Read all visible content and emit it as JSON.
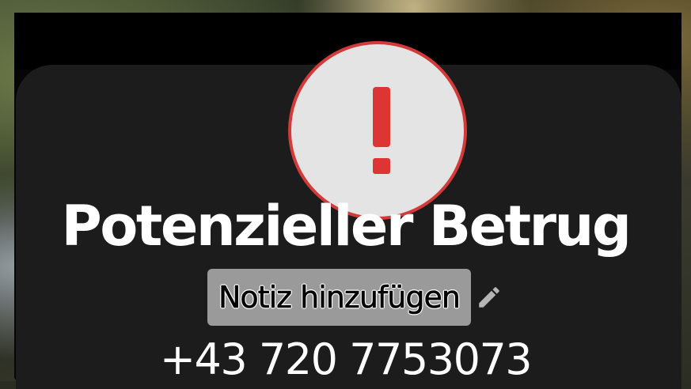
{
  "alert": {
    "icon": "exclamation-icon",
    "icon_color": "#dd3434",
    "circle_color": "#e4e4e4"
  },
  "caller": {
    "title": "Potenzieller Betrug",
    "add_note_label": "Notiz hinzufügen",
    "edit_icon": "pencil-icon",
    "phone_number": "+43 720 7753073"
  },
  "colors": {
    "card_background": "#1c1c1c",
    "text": "#ffffff",
    "note_button": "#9a9a9a"
  }
}
